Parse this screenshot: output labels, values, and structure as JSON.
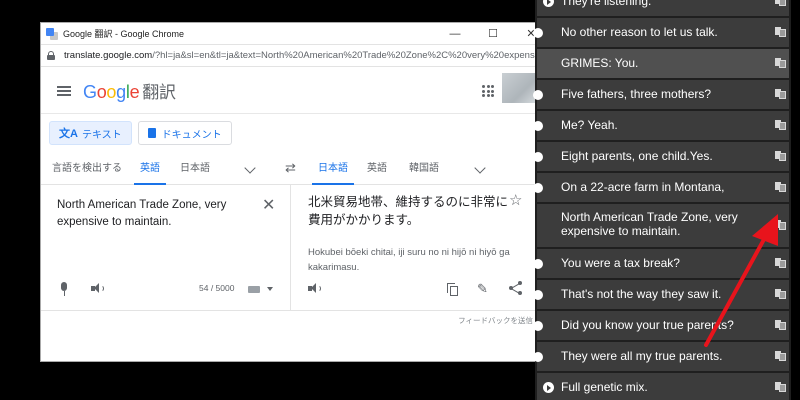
{
  "window": {
    "title": "Google 翻訳 - Google Chrome",
    "controls": {
      "minimize": "—",
      "maximize": "☐",
      "close": "✕"
    }
  },
  "address": {
    "host": "translate.google.com",
    "path": "/?hl=ja&sl=en&tl=ja&text=North%20American%20Trade%20Zone%2C%20very%20expensiv..."
  },
  "header": {
    "logo_letters": [
      "G",
      "o",
      "o",
      "g",
      "l",
      "e"
    ],
    "logo_suffix": "翻訳"
  },
  "modes": {
    "text_label": "テキスト",
    "documents_label": "ドキュメント"
  },
  "languages": {
    "source": [
      "言語を検出する",
      "英語",
      "日本語"
    ],
    "source_selected": "英語",
    "target": [
      "日本語",
      "英語",
      "韓国語"
    ],
    "target_selected": "日本語"
  },
  "source": {
    "text": "North American Trade Zone, very expensive to maintain.",
    "char_count": "54 / 5000"
  },
  "target": {
    "text": "北米貿易地帯、維持するのに非常に費用がかかります。",
    "romanization": "Hokubei bōeki chitai, iji suru no ni hijō ni hiyō ga kakarimasu."
  },
  "feedback_label": "フィードバックを送信",
  "subtitles": {
    "items": [
      {
        "text": "They're listening.",
        "icon": "play-icon"
      },
      {
        "text": "No other reason to let us talk.",
        "icon": "half-dot"
      },
      {
        "text": "GRIMES: You.",
        "icon": "none"
      },
      {
        "text": "Five fathers, three mothers?",
        "icon": "half-dot"
      },
      {
        "text": "Me? Yeah.",
        "icon": "half-dot"
      },
      {
        "text": "Eight parents, one child.Yes.",
        "icon": "half-dot"
      },
      {
        "text": "On a 22-acre farm in Montana,",
        "icon": "half-dot"
      },
      {
        "text": "North American Trade Zone, very expensive to maintain.",
        "icon": "none"
      },
      {
        "text": "You were a tax break?",
        "icon": "half-dot"
      },
      {
        "text": "That's not the way they saw it.",
        "icon": "half-dot"
      },
      {
        "text": "Did you know your true parents?",
        "icon": "half-dot"
      },
      {
        "text": "They were all my true parents.",
        "icon": "half-dot"
      },
      {
        "text": "Full genetic mix.",
        "icon": "play-icon"
      }
    ]
  },
  "colors": {
    "accent_blue": "#1a73e8",
    "arrow_red": "#e8141c",
    "subtitle_row": "#3c3c3c",
    "subtitle_highlight": "#505050"
  }
}
